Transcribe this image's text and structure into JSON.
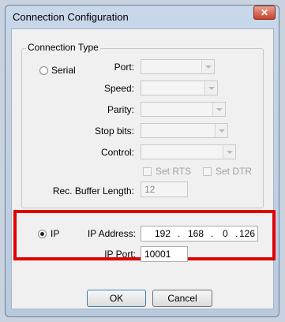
{
  "window": {
    "title": "Connection Configuration"
  },
  "group": {
    "label": "Connection Type"
  },
  "serial": {
    "radio_label": "Serial",
    "selected": false,
    "port_label": "Port:",
    "speed_label": "Speed:",
    "parity_label": "Parity:",
    "stopbits_label": "Stop bits:",
    "control_label": "Control:",
    "set_rts_label": "Set RTS",
    "set_dtr_label": "Set DTR",
    "rec_buffer_label": "Rec. Buffer Length:",
    "rec_buffer_value": "12"
  },
  "ip": {
    "radio_label": "IP",
    "selected": true,
    "address_label": "IP Address:",
    "octets": [
      "192",
      "168",
      "0",
      "126"
    ],
    "port_label": "IP Port:",
    "port_value": "10001"
  },
  "buttons": {
    "ok": "OK",
    "cancel": "Cancel"
  },
  "icons": {
    "close": "close-icon"
  },
  "colors": {
    "highlight_border": "#e00000"
  }
}
